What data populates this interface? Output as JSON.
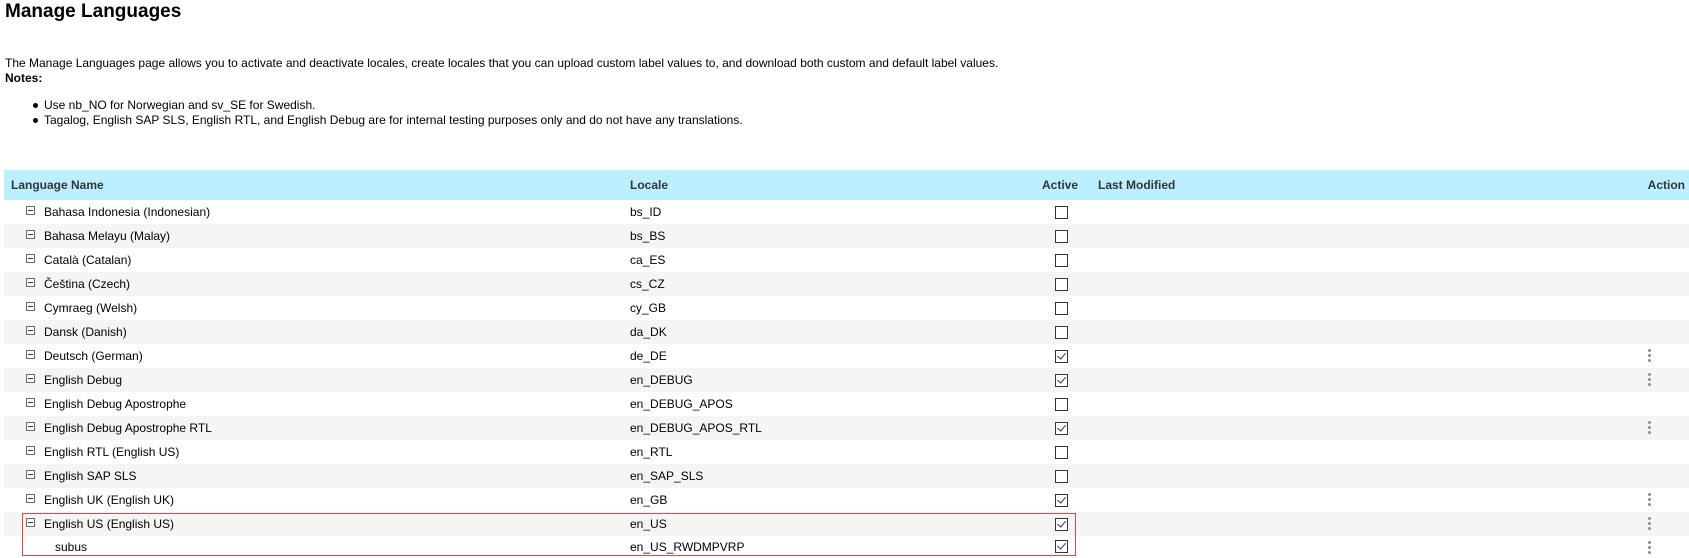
{
  "page": {
    "title": "Manage Languages",
    "intro": "The Manage Languages page allows you to activate and deactivate locales, create locales that you can upload custom label values to, and download both custom and default label values.",
    "notes_label": "Notes:",
    "notes": [
      "Use nb_NO for Norwegian and sv_SE for Swedish.",
      "Tagalog, English SAP SLS, English RTL, and English Debug are for internal testing purposes only and do not have any translations."
    ]
  },
  "table": {
    "columns": {
      "name": "Language Name",
      "locale": "Locale",
      "active": "Active",
      "last_modified": "Last Modified",
      "action": "Action"
    },
    "rows": [
      {
        "name": "Bahasa Indonesia (Indonesian)",
        "locale": "bs_ID",
        "active": false,
        "has_action": false
      },
      {
        "name": "Bahasa Melayu (Malay)",
        "locale": "bs_BS",
        "active": false,
        "has_action": false
      },
      {
        "name": "Català (Catalan)",
        "locale": "ca_ES",
        "active": false,
        "has_action": false
      },
      {
        "name": "Čeština (Czech)",
        "locale": "cs_CZ",
        "active": false,
        "has_action": false
      },
      {
        "name": "Cymraeg (Welsh)",
        "locale": "cy_GB",
        "active": false,
        "has_action": false
      },
      {
        "name": "Dansk (Danish)",
        "locale": "da_DK",
        "active": false,
        "has_action": false
      },
      {
        "name": "Deutsch (German)",
        "locale": "de_DE",
        "active": true,
        "has_action": true
      },
      {
        "name": "English Debug",
        "locale": "en_DEBUG",
        "active": true,
        "has_action": true
      },
      {
        "name": "English Debug Apostrophe",
        "locale": "en_DEBUG_APOS",
        "active": false,
        "has_action": false
      },
      {
        "name": "English Debug Apostrophe RTL",
        "locale": "en_DEBUG_APOS_RTL",
        "active": true,
        "has_action": true
      },
      {
        "name": "English RTL (English US)",
        "locale": "en_RTL",
        "active": false,
        "has_action": false
      },
      {
        "name": "English SAP SLS",
        "locale": "en_SAP_SLS",
        "active": false,
        "has_action": false
      },
      {
        "name": "English UK (English UK)",
        "locale": "en_GB",
        "active": true,
        "has_action": true
      },
      {
        "name": "English US (English US)",
        "locale": "en_US",
        "active": true,
        "has_action": true
      },
      {
        "name": "subus",
        "locale": "en_US_RWDMPVRP",
        "active": true,
        "has_action": true,
        "child": true
      }
    ]
  },
  "colors": {
    "header_bg": "#bcefff",
    "alt_row_bg": "#f5f5f5",
    "highlight_border": "#e04848"
  },
  "icons": {
    "expander": "collapse-square-icon",
    "action": "vertical-ellipsis-icon",
    "checkbox": "checkbox-icon"
  }
}
